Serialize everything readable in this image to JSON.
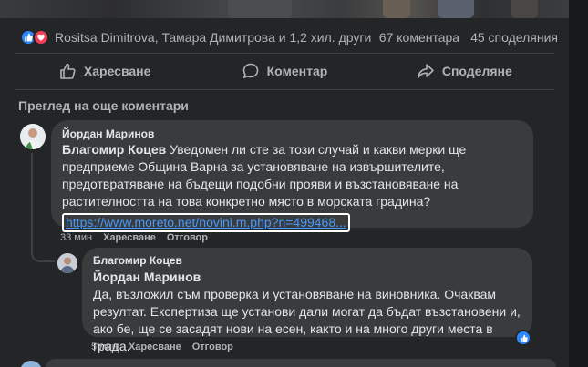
{
  "post": {
    "reactions": [
      "like",
      "love"
    ],
    "reactors_text": "Rositsa Dimitrova, Тамара Димитрова и 1,2 хил. други",
    "comments_count": "67 коментара",
    "shares_count": "45 споделяния"
  },
  "actions": {
    "like": "Харесване",
    "comment": "Коментар",
    "share": "Споделяне"
  },
  "more_comments": "Преглед на още коментари",
  "comments": [
    {
      "author": "Йордан Маринов",
      "mention": "Благомир Коцев",
      "text": " Уведомен ли сте за този случай и какви мерки ще предприеме Община Варна за установяване на извършителите, предотвратяване на бъдещи подобни прояви и възстановяване на растителността на това конкретно място в морската градина?",
      "link": "https://www.moreto.net/novini.m.php?n=499468...",
      "time": "33 мин",
      "like_label": "Харесване",
      "reply_label": "Отговор"
    },
    {
      "author": "Благомир Коцев",
      "mention": "Йордан Маринов",
      "text": "Да, възложил съм проверка и установяване на виновника. Очаквам резултат. Експертиза ще установи дали могат да бъдат възстановени и, ако бе, ще се засадят нови на есен, както и на много други места в града.",
      "time": "5 мин",
      "like_label": "Харесване",
      "reply_label": "Отговор"
    }
  ],
  "colors": {
    "background": "#242526",
    "bubble": "#3a3b3c",
    "link": "#4599ff",
    "like_blue": "#2d88ff",
    "love_red": "#f33e58"
  }
}
